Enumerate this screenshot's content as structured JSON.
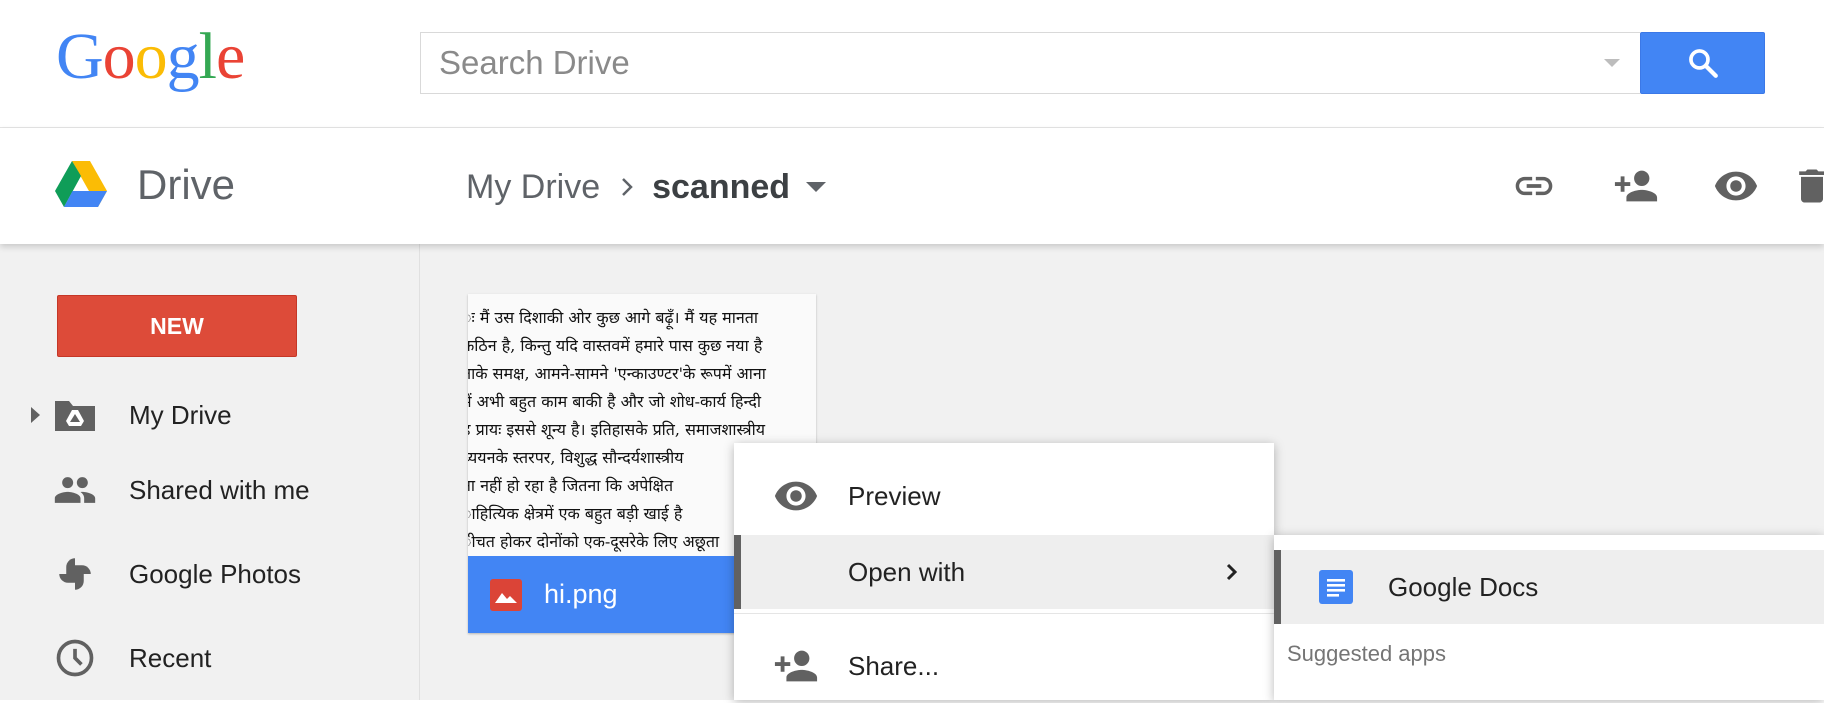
{
  "header": {
    "logo_letters": [
      "G",
      "o",
      "o",
      "g",
      "l",
      "e"
    ],
    "logo_colors": [
      "#4285f4",
      "#ea4335",
      "#fbbc05",
      "#4285f4",
      "#34a853",
      "#ea4335"
    ],
    "search_placeholder": "Search Drive",
    "search_button_icon": "search-icon"
  },
  "appbar": {
    "app_name": "Drive",
    "breadcrumb": {
      "root": "My Drive",
      "current": "scanned"
    },
    "actions": [
      {
        "name": "get-link-button",
        "icon": "link-icon"
      },
      {
        "name": "share-button",
        "icon": "add-person-icon"
      },
      {
        "name": "preview-button",
        "icon": "eye-icon"
      },
      {
        "name": "remove-button",
        "icon": "trash-icon"
      }
    ]
  },
  "sidebar": {
    "new_label": "NEW",
    "items": [
      {
        "label": "My Drive",
        "icon": "drive-folder-icon",
        "expandable": true
      },
      {
        "label": "Shared with me",
        "icon": "people-icon"
      },
      {
        "label": "Google Photos",
        "icon": "pinwheel-icon"
      },
      {
        "label": "Recent",
        "icon": "clock-icon"
      }
    ]
  },
  "file": {
    "name": "hi.png",
    "type_icon": "image-icon",
    "preview_lines": [
      "ः  मैं उस दिशाकी ओर कुछ आगे बढ़ूँ।  मैं यह मानता",
      " कठिन है,   किन्तु यदि वास्तवमें हमारे पास कुछ नया है",
      "ताके समक्ष,  आमने-सामने  'एन्काउण्टर'के   रूपमें आना",
      "में अभी बहुत  काम बाकी है और  जो शोध-कार्य   हिन्दी",
      "ह प्रायः इससे शून्य है।  इतिहासके प्रति, समाजशास्त्रीय",
      "ध्ययनके स्तरपर,   विशुद्ध   सौन्दर्यशास्त्रीय",
      "ना  नहीं हो  रहा है  जितना कि अपेक्षित",
      "ाहित्यिक  क्षेत्रमें एक   बहुत बड़ी खाई है",
      "ीचत होकर दोनोंको एक-दूसरेके लिए अछूता"
    ]
  },
  "context_menu": {
    "items": [
      {
        "label": "Preview",
        "icon": "eye-icon"
      },
      {
        "label": "Open with",
        "icon": "",
        "has_submenu": true
      },
      {
        "label": "Share...",
        "icon": "add-person-icon"
      }
    ]
  },
  "open_with_menu": {
    "item": {
      "label": "Google Docs",
      "icon": "google-docs-icon"
    },
    "section_heading": "Suggested apps"
  }
}
